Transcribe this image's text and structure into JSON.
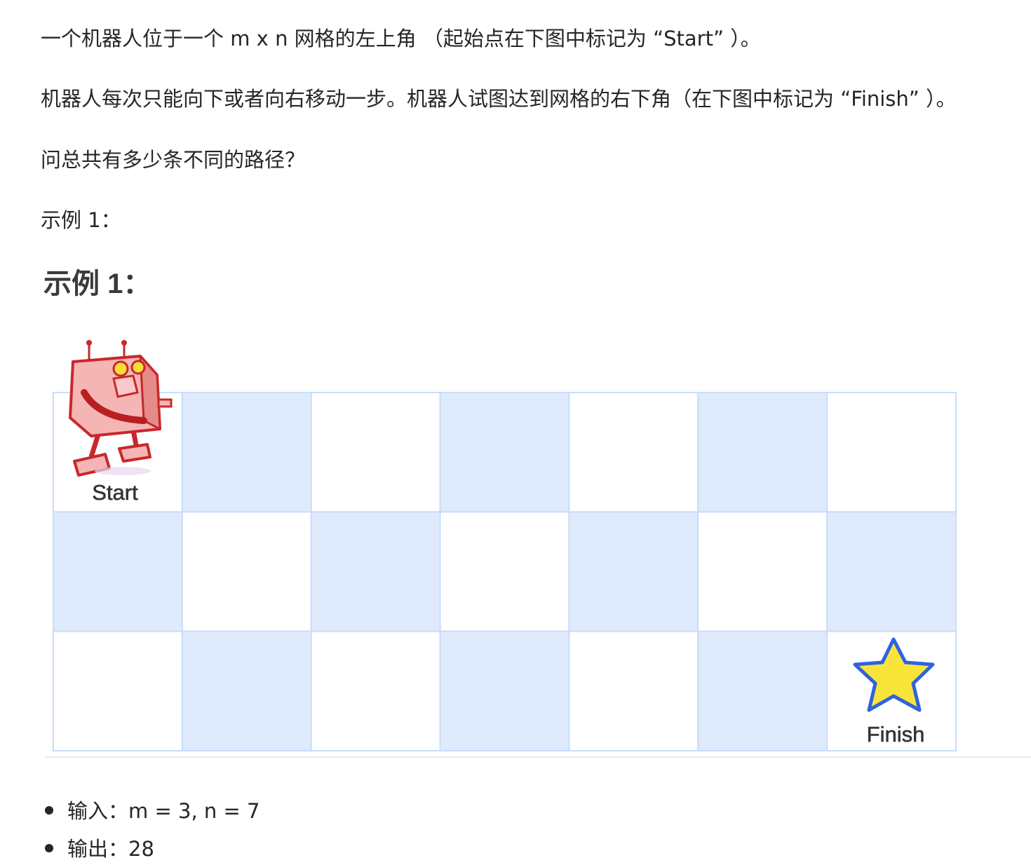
{
  "description": {
    "line1": "一个机器人位于一个 m x n 网格的左上角 （起始点在下图中标记为 “Start” ）。",
    "line2": "机器人每次只能向下或者向右移动一步。机器人试图达到网格的右下角（在下图中标记为 “Finish” ）。",
    "line3": "问总共有多少条不同的路径？",
    "line4": "示例 1："
  },
  "figure": {
    "heading": "示例 1：",
    "rows": 3,
    "cols": 7,
    "start_label": "Start",
    "finish_label": "Finish",
    "colors": {
      "shaded_cell": "#dfeafc",
      "cell_border": "#c9dcfb",
      "star_fill": "#f9e53a",
      "star_stroke": "#2f62e0",
      "robot_body": "#f2a9a9",
      "robot_outline": "#c8282a"
    }
  },
  "results": {
    "input_label": "输入：",
    "input_value": "m = 3, n = 7",
    "output_label": "输出：",
    "output_value": "28"
  }
}
